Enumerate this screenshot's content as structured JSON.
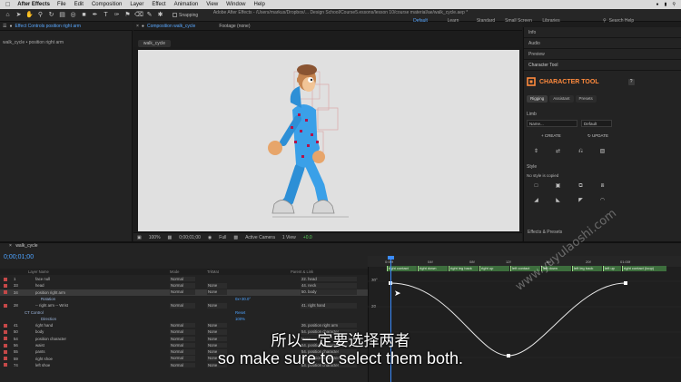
{
  "menubar": {
    "app_name": "After Effects",
    "items": [
      "File",
      "Edit",
      "Composition",
      "Layer",
      "Effect",
      "Animation",
      "View",
      "Window",
      "Help"
    ]
  },
  "toolbar": {
    "snapping_label": "Snapping",
    "doc_title": "Adobe After Effects - /Users/markus/Dropbox/... Design School/Course5.essons/lesson 10/course material/ae/walk_cycle.aep *",
    "workspaces": [
      "Default",
      "Learn",
      "Standard",
      "Small Screen",
      "Libraries"
    ],
    "active_workspace": "Default",
    "search_label": "Search Help"
  },
  "left_panel": {
    "tab_label": "Effect Controls position right arm",
    "comp_label": "walk_cycle • position right arm"
  },
  "viewer": {
    "tab_label": "Composition walk_cycle",
    "footage_tab": "Footage (none)",
    "subtab": "walk_cycle",
    "zoom": "100%",
    "timecode": "0;00;01;00",
    "resolution": "Full",
    "camera": "Active Camera",
    "views": "1 View",
    "exposure": "+0.0"
  },
  "right_panel": {
    "rows": [
      "Info",
      "Audio",
      "Preview"
    ],
    "tool_panel_title": "Character Tool",
    "character_tool": {
      "title": "CHARACTER TOOL",
      "help": "?",
      "tabs": [
        "Rigging",
        "Assistant",
        "Presets"
      ],
      "active_tab": "Rigging",
      "limb_label": "Limb",
      "name_placeholder": "Name...",
      "preset_value": "Default",
      "create_label": "CREATE",
      "update_label": "UPDATE",
      "style_label": "Style",
      "style_status": "No style is copied"
    },
    "bottom_row": "Effects & Presets"
  },
  "timeline": {
    "comp_tab": "walk_cycle",
    "timecode": "0;00;01;00",
    "columns": {
      "layer_name": "Layer Name",
      "mode": "Mode",
      "trkmat": "TrkMat",
      "parent": "Parent & Link"
    },
    "layers": [
      {
        "num": "1",
        "name": "face null",
        "mode": "Normal",
        "trk": "",
        "parent": "22. head",
        "color": "#c44848"
      },
      {
        "num": "33",
        "name": "head",
        "mode": "Normal",
        "trk": "None",
        "parent": "44. neck",
        "color": "#c44848"
      },
      {
        "num": "34",
        "name": "position right arm",
        "mode": "Normal",
        "trk": "None",
        "parent": "50. body",
        "color": "#c44848"
      },
      {
        "num": "",
        "name": "Rotation",
        "mode": "",
        "trk": "",
        "parent": "",
        "color": "",
        "value": "0x+30.0°"
      },
      {
        "num": "28",
        "name": "-- right arm -- Wrist",
        "mode": "Normal",
        "trk": "None",
        "parent": "41. right hand",
        "color": "#c44848"
      },
      {
        "num": "",
        "name": "CT Control",
        "mode": "",
        "trk": "",
        "parent": "",
        "color": "",
        "value": "Reset"
      },
      {
        "num": "",
        "name": "Direction",
        "mode": "",
        "trk": "",
        "parent": "",
        "color": "",
        "value": "100%"
      },
      {
        "num": "41",
        "name": "right hand",
        "mode": "Normal",
        "trk": "None",
        "parent": "26. position right arm",
        "color": "#c44848"
      },
      {
        "num": "50",
        "name": "body",
        "mode": "Normal",
        "trk": "None",
        "parent": "54. position character",
        "color": "#c44848"
      },
      {
        "num": "54",
        "name": "position character",
        "mode": "Normal",
        "trk": "None",
        "parent": "None",
        "color": "#c44848"
      },
      {
        "num": "56",
        "name": "waist",
        "mode": "Normal",
        "trk": "None",
        "parent": "54. position character",
        "color": "#c44848"
      },
      {
        "num": "55",
        "name": "pants",
        "mode": "Normal",
        "trk": "None",
        "parent": "54. position character",
        "color": "#c44848"
      },
      {
        "num": "59",
        "name": "right shoe",
        "mode": "Normal",
        "trk": "None",
        "parent": "54. position character",
        "color": "#c44848"
      },
      {
        "num": "74",
        "name": "left shoe",
        "mode": "Normal",
        "trk": "None",
        "parent": "54. position character",
        "color": "#c44848"
      }
    ],
    "ruler_labels": [
      "0:00f",
      "04f",
      "08f",
      "12f",
      "16f",
      "20f",
      "01:00f"
    ],
    "markers": [
      "right contact",
      "right down",
      "right leg back",
      "right up",
      "left contact",
      "left down",
      "left leg back",
      "left up",
      "right contact (loop)"
    ],
    "graph_labels": [
      "30°",
      "20"
    ]
  },
  "subtitles": {
    "chinese": "所以一定要选择两者",
    "english": "so make sure to select them both."
  },
  "watermark": "www.yuyulaoshi.com",
  "colors": {
    "accent_blue": "#4da3ff",
    "ct_orange": "#ff8a3d",
    "character_blue": "#3aa0e8"
  }
}
